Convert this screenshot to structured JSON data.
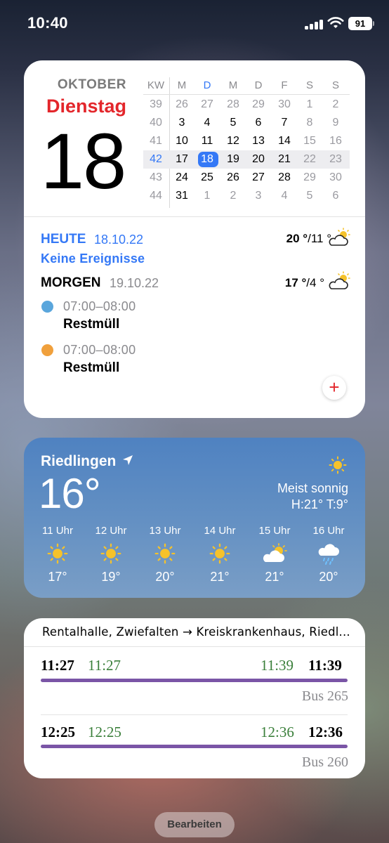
{
  "status": {
    "time": "10:40",
    "battery": "91"
  },
  "calendar": {
    "month": "OKTOBER",
    "weekday": "Dienstag",
    "day": "18",
    "headers": [
      "KW",
      "M",
      "D",
      "M",
      "D",
      "F",
      "S",
      "S"
    ],
    "weeks": [
      {
        "kw": "39",
        "days": [
          "26",
          "27",
          "28",
          "29",
          "30",
          "1",
          "2"
        ]
      },
      {
        "kw": "40",
        "days": [
          "3",
          "4",
          "5",
          "6",
          "7",
          "8",
          "9"
        ]
      },
      {
        "kw": "41",
        "days": [
          "10",
          "11",
          "12",
          "13",
          "14",
          "15",
          "16"
        ]
      },
      {
        "kw": "42",
        "days": [
          "17",
          "18",
          "19",
          "20",
          "21",
          "22",
          "23"
        ]
      },
      {
        "kw": "43",
        "days": [
          "24",
          "25",
          "26",
          "27",
          "28",
          "29",
          "30"
        ]
      },
      {
        "kw": "44",
        "days": [
          "31",
          "1",
          "2",
          "3",
          "4",
          "5",
          "6"
        ]
      }
    ],
    "today_label": "HEUTE",
    "today_date": "18.10.22",
    "no_events": "Keine Ereignisse",
    "today_weather_high": "20 °",
    "today_weather_low": "/11 °",
    "tomorrow_label": "MORGEN",
    "tomorrow_date": "19.10.22",
    "tomorrow_weather_high": "17 °",
    "tomorrow_weather_low": "/4 °",
    "events": [
      {
        "time": "07:00–08:00",
        "title": "Restmüll",
        "color": "#5aa6dc"
      },
      {
        "time": "07:00–08:00",
        "title": "Restmüll",
        "color": "#f0a03c"
      }
    ],
    "add_symbol": "+"
  },
  "weather": {
    "city": "Riedlingen",
    "temp": "16°",
    "condition": "Meist sonnig",
    "high_low": "H:21° T:9°",
    "hours": [
      {
        "label": "11 Uhr",
        "icon": "sun-icon",
        "temp": "17°"
      },
      {
        "label": "12 Uhr",
        "icon": "sun-icon",
        "temp": "19°"
      },
      {
        "label": "13 Uhr",
        "icon": "sun-icon",
        "temp": "20°"
      },
      {
        "label": "14 Uhr",
        "icon": "sun-icon",
        "temp": "21°"
      },
      {
        "label": "15 Uhr",
        "icon": "partly-cloudy-icon",
        "temp": "21°"
      },
      {
        "label": "16 Uhr",
        "icon": "rain-cloud-icon",
        "temp": "20°"
      }
    ]
  },
  "transit": {
    "route": "Rentalhalle, Zwiefalten → Kreiskrankenhaus, Riedl...",
    "departures": [
      {
        "dep_sched": "11:27",
        "dep_real": "11:27",
        "arr_real": "11:39",
        "arr_sched": "11:39",
        "line": "Bus 265"
      },
      {
        "dep_sched": "12:25",
        "dep_real": "12:25",
        "arr_real": "12:36",
        "arr_sched": "12:36",
        "line": "Bus 260"
      }
    ]
  },
  "edit_button": "Bearbeiten"
}
